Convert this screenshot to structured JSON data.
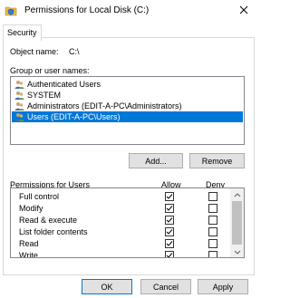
{
  "window": {
    "title": "Permissions for Local Disk (C:)",
    "close_icon": "close-icon",
    "app_icon": "shield-folder-icon"
  },
  "tabs": [
    {
      "label": "Security",
      "selected": true
    }
  ],
  "object": {
    "label": "Object name:",
    "value": "C:\\"
  },
  "groups": {
    "label": "Group or user names:",
    "items": [
      {
        "label": "Authenticated Users",
        "icon": "users-icon",
        "selected": false
      },
      {
        "label": "SYSTEM",
        "icon": "users-icon",
        "selected": false
      },
      {
        "label": "Administrators (EDIT-A-PC\\Administrators)",
        "icon": "users-icon",
        "selected": false
      },
      {
        "label": "Users (EDIT-A-PC\\Users)",
        "icon": "users-icon",
        "selected": true
      }
    ],
    "selection_color": "#0078d7"
  },
  "group_buttons": {
    "add": "Add...",
    "remove": "Remove"
  },
  "permissions": {
    "label": "Permissions for Users",
    "allow_header": "Allow",
    "deny_header": "Deny",
    "rows": [
      {
        "name": "Full control",
        "allow": true,
        "deny": false
      },
      {
        "name": "Modify",
        "allow": true,
        "deny": false
      },
      {
        "name": "Read & execute",
        "allow": true,
        "deny": false
      },
      {
        "name": "List folder contents",
        "allow": true,
        "deny": false
      },
      {
        "name": "Read",
        "allow": true,
        "deny": false
      },
      {
        "name": "Write",
        "allow": true,
        "deny": false
      }
    ]
  },
  "footer": {
    "ok": "OK",
    "cancel": "Cancel",
    "apply": "Apply"
  }
}
